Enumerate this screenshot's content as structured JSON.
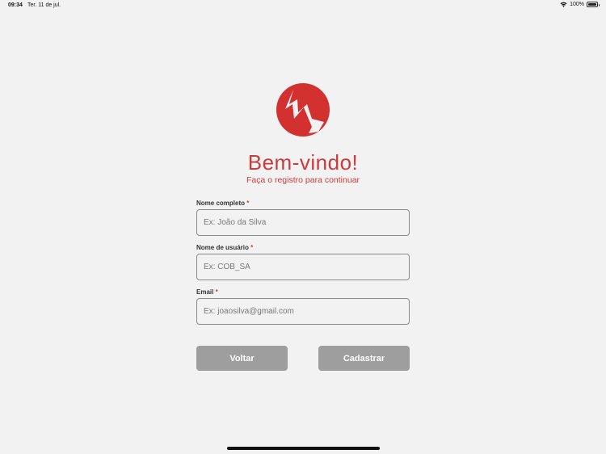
{
  "status_bar": {
    "time": "09:34",
    "date": "Ter. 11 de jul.",
    "battery": "100%",
    "battery_level": 1.0
  },
  "header": {
    "title": "Bem-vindo!",
    "subtitle": "Faça o registro para continuar"
  },
  "form": {
    "fields": [
      {
        "label": "Nome completo",
        "required_mark": "*",
        "placeholder": "Ex: João da Silva",
        "value": ""
      },
      {
        "label": "Nome de usuário",
        "required_mark": "*",
        "placeholder": "Ex: COB_SA",
        "value": ""
      },
      {
        "label": "Email",
        "required_mark": "*",
        "placeholder": "Ex: joaosilva@gmail.com",
        "value": ""
      }
    ]
  },
  "buttons": {
    "back_label": "Voltar",
    "register_label": "Cadastrar"
  },
  "colors": {
    "brand": "#cc3b3b",
    "background": "#f2f2f2",
    "button": "#9e9e9e"
  },
  "icons": {
    "logo": "brand-logo-icon",
    "wifi": "wifi-icon",
    "battery": "battery-icon"
  }
}
